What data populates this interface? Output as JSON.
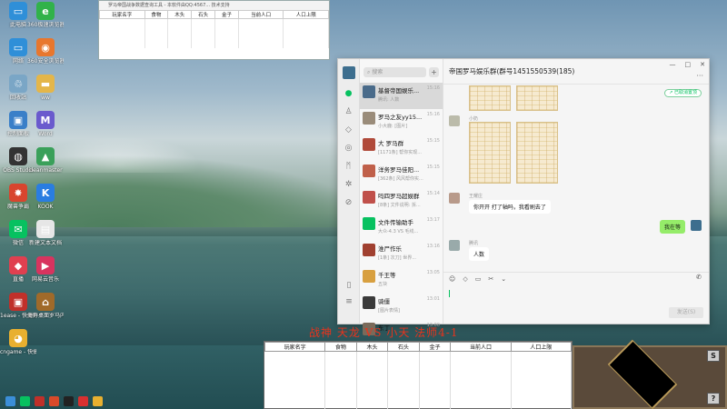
{
  "desktop": {
    "icons": [
      {
        "label": "此电脑",
        "glyph": "▭",
        "color": "#2f8fd8"
      },
      {
        "label": "360极速浏览器",
        "glyph": "e",
        "color": "#31b24a"
      },
      {
        "label": "网络",
        "glyph": "▭",
        "color": "#2f8fd8"
      },
      {
        "label": "360安全浏览器",
        "glyph": "◉",
        "color": "#e8772e"
      },
      {
        "label": "回收站",
        "glyph": "♲",
        "color": "#7aa6c6"
      },
      {
        "label": "ww",
        "glyph": "▬",
        "color": "#e4b64a"
      },
      {
        "label": "控制面板",
        "glyph": "▣",
        "color": "#3a7fc8"
      },
      {
        "label": "Word",
        "glyph": "M",
        "color": "#6a5acd"
      },
      {
        "label": "OBS Studio",
        "glyph": "◍",
        "color": "#333"
      },
      {
        "label": "cleanmaster",
        "glyph": "▲",
        "color": "#3aa05a"
      },
      {
        "label": "魔兽争霸",
        "glyph": "✸",
        "color": "#d8452e"
      },
      {
        "label": "KOOK",
        "glyph": "K",
        "color": "#2a7de1"
      },
      {
        "label": "微信",
        "glyph": "✉",
        "color": "#07c160"
      },
      {
        "label": "新建文本文档",
        "glyph": "▤",
        "color": "#e6e6e6"
      },
      {
        "label": "直播",
        "glyph": "◆",
        "color": "#e04050"
      },
      {
        "label": "网易云音乐",
        "glyph": "▶",
        "color": "#d8345f"
      },
      {
        "label": "1ease - 快捷方式",
        "glyph": "▣",
        "color": "#c0302a"
      },
      {
        "label": "海鲜桌面罗马内斯",
        "glyph": "⌂",
        "color": "#a06a2a"
      },
      {
        "label": "cngame - 快捷方式",
        "glyph": "◕",
        "color": "#e8b030"
      }
    ]
  },
  "mini_window": {
    "title": "罗马帝国战争数据查询工具 - 本软件由QQ:4567... 技术支持",
    "columns": [
      "玩家名字",
      "食物",
      "木头",
      "石头",
      "金子",
      "当前人口",
      "人口上限"
    ]
  },
  "chat": {
    "search_placeholder": "搜索",
    "plus": "+",
    "title": "帝国罗马娱乐群(群号1451550539(185)",
    "window_controls": [
      "—",
      "□",
      "✕"
    ],
    "more": "···",
    "pill": "↗ 已取消置顶",
    "conversations": [
      {
        "name": "基督帝国娱乐...",
        "time": "15:16",
        "preview": "腾讯: 人数",
        "color": "#4a6b8a",
        "selected": true
      },
      {
        "name": "罗马之友yy15...",
        "time": "15:16",
        "preview": "小大鹿: [图片]",
        "color": "#9a8c7a",
        "selected": false
      },
      {
        "name": "大 罗马群",
        "time": "15:15",
        "preview": "[1171条] 帮你实现...",
        "color": "#b04a3a",
        "selected": false
      },
      {
        "name": "洋务罗马佳阳...",
        "time": "15:15",
        "preview": "[362条] 风风帮你实...",
        "color": "#c0604a",
        "selected": false
      },
      {
        "name": "吗四罗马超娱群",
        "time": "15:14",
        "preview": "[8条] 文件说明: 拆...",
        "color": "#c0504a",
        "selected": false
      },
      {
        "name": "文件传输助手",
        "time": "13:17",
        "preview": "大众-4.3 VS 毛线...",
        "color": "#07c160",
        "selected": false
      },
      {
        "name": "淮尸作乐",
        "time": "13:16",
        "preview": "[1条] 次刀] 世界...",
        "color": "#a04030",
        "selected": false
      },
      {
        "name": "千王等",
        "time": "13:05",
        "preview": "五块",
        "color": "#d8a040",
        "selected": false
      },
      {
        "name": "骑僵",
        "time": "13:01",
        "preview": "[图片表情]",
        "color": "#3a3a3a",
        "selected": false
      },
      {
        "name": "东丁",
        "time": "13:00",
        "preview": "",
        "color": "#7a6a5a",
        "selected": false
      }
    ],
    "messages": [
      {
        "sender": "小奶",
        "text": ""
      },
      {
        "sender": "王耀庄",
        "text": "你开开 打了轴吗，我看刷去了"
      },
      {
        "sender": "我",
        "text": "我在等"
      },
      {
        "sender": "腾讯",
        "text": "人数"
      }
    ],
    "toolbar_icons": [
      "☺",
      "◇",
      "▭",
      "✂",
      "⌄"
    ],
    "send_label": "发送(S)"
  },
  "game": {
    "vs_title": "战神 天龙 VS 小天 法师4-1",
    "columns": [
      "玩家名字",
      "食物",
      "木头",
      "石头",
      "金子",
      "当前人口",
      "人口上限"
    ],
    "map_buttons": [
      "S",
      "?"
    ]
  },
  "taskbar": {
    "items": [
      {
        "name": "windows-start-icon",
        "color": "#3b8ed8"
      },
      {
        "name": "wechat-taskbar-icon",
        "color": "#07c160"
      },
      {
        "name": "game-taskbar-icon",
        "color": "#c0302a"
      },
      {
        "name": "app-taskbar-icon",
        "color": "#d84a2a"
      },
      {
        "name": "penguin-taskbar-icon",
        "color": "#222"
      },
      {
        "name": "game2-taskbar-icon",
        "color": "#d83030"
      },
      {
        "name": "folder-taskbar-icon",
        "color": "#e8b030"
      }
    ]
  }
}
